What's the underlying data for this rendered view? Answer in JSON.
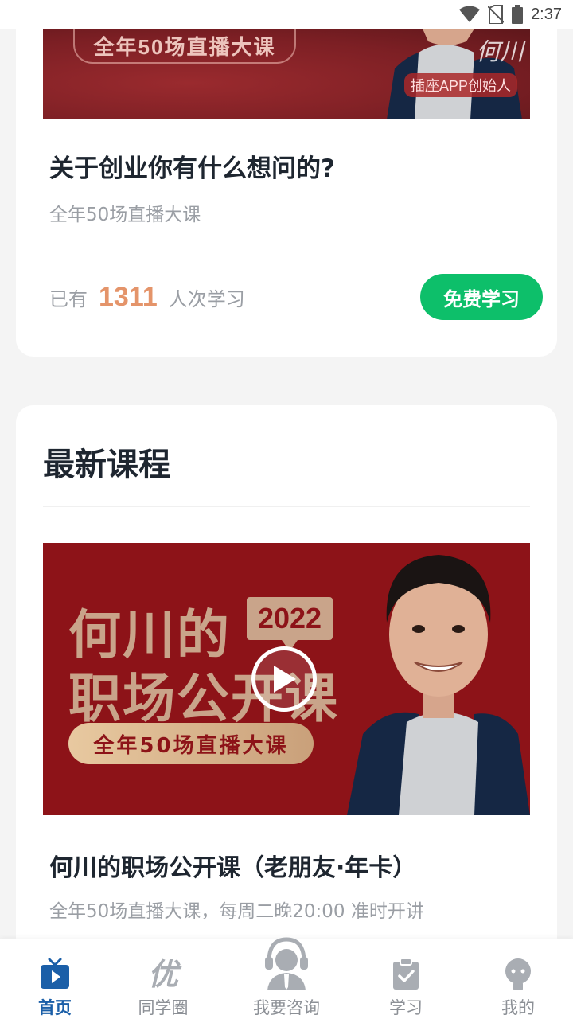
{
  "status_bar": {
    "time": "2:37"
  },
  "featured_course": {
    "banner_pill_text": "全年50场直播大课",
    "banner_founder_tag": "插座APP创始人",
    "banner_signature": "何川",
    "title": "关于创业你有什么想问的?",
    "subtitle": "全年50场直播大课",
    "stats_prefix": "已有",
    "stats_count": "1311",
    "stats_suffix": "人次学习",
    "button_label": "免费学习"
  },
  "latest": {
    "section_title": "最新课程",
    "banner": {
      "line1": "何川的",
      "year": "2022",
      "line2": "职场公开课",
      "pill": "全年50场直播大课"
    },
    "course_title": "何川的职场公开课（老朋友·年卡）",
    "course_subtitle": "全年50场直播大课，每周二晚20:00 准时开讲"
  },
  "bottom_nav": {
    "items": [
      {
        "label": "首页",
        "icon": "tv-play-icon",
        "active": true
      },
      {
        "label": "同学圈",
        "icon": "you-char-icon",
        "active": false
      },
      {
        "label": "我要咨询",
        "icon": "headset-consultant-icon",
        "active": false
      },
      {
        "label": "学习",
        "icon": "clipboard-check-icon",
        "active": false
      },
      {
        "label": "我的",
        "icon": "profile-robot-icon",
        "active": false
      }
    ]
  },
  "colors": {
    "accent_green": "#0dbf6a",
    "count_orange": "#e4946a",
    "nav_active": "#1b5fa8",
    "banner_red": "#8d1318"
  }
}
